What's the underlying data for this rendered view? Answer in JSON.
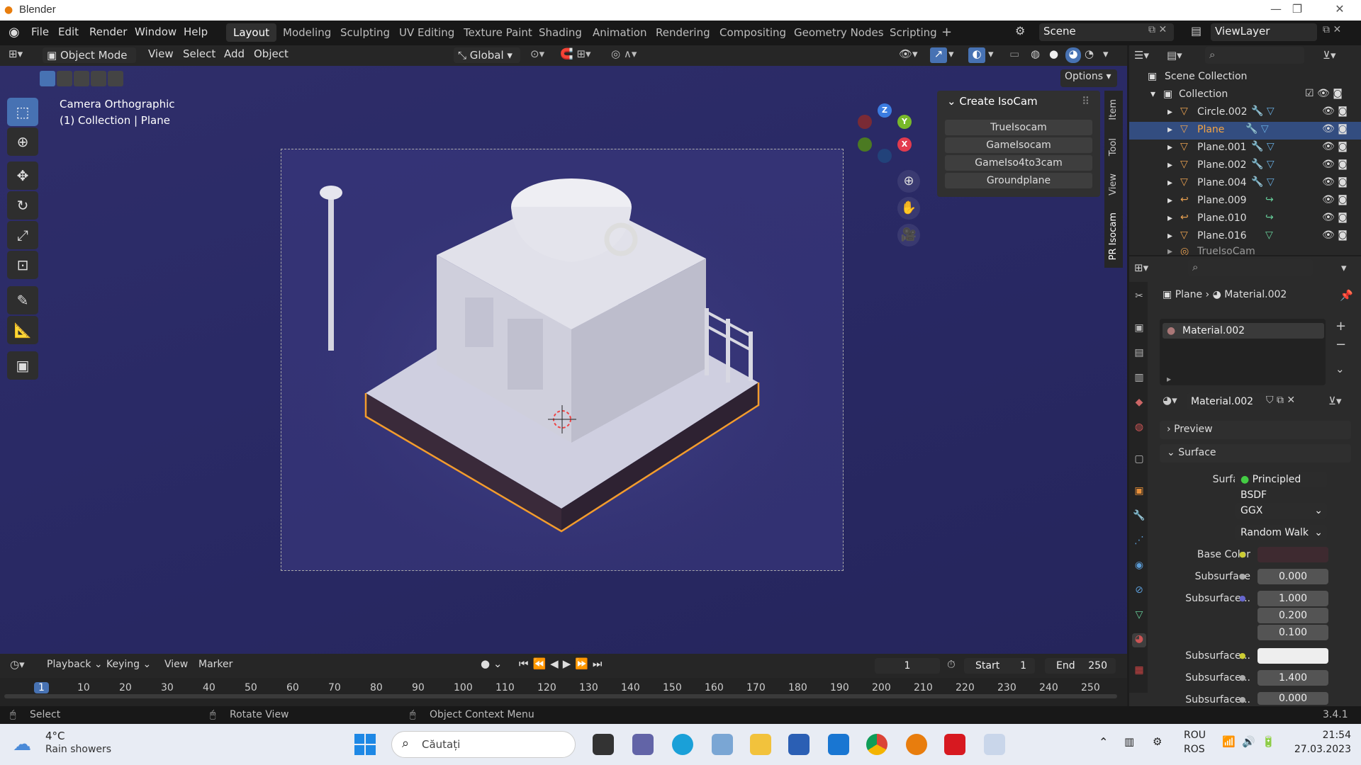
{
  "titlebar": {
    "app": "Blender"
  },
  "menu": [
    "File",
    "Edit",
    "Render",
    "Window",
    "Help"
  ],
  "workspaces": [
    "Layout",
    "Modeling",
    "Sculpting",
    "UV Editing",
    "Texture Paint",
    "Shading",
    "Animation",
    "Rendering",
    "Compositing",
    "Geometry Nodes",
    "Scripting"
  ],
  "scene": {
    "name": "Scene",
    "view_layer": "ViewLayer"
  },
  "viewport_header": {
    "mode": "Object Mode",
    "items": [
      "View",
      "Select",
      "Add",
      "Object"
    ],
    "orientation": "Global",
    "options": "Options"
  },
  "viewport": {
    "camera_label": "Camera Orthographic",
    "collection_label": "(1) Collection | Plane"
  },
  "npanel": {
    "title": "Create IsoCam",
    "buttons": [
      "TrueIsocam",
      "GameIsocam",
      "GameIso4to3cam",
      "Groundplane"
    ],
    "tabs": [
      "Item",
      "Tool",
      "View",
      "PR Isocam"
    ]
  },
  "outliner": {
    "root": "Scene Collection",
    "collection": "Collection",
    "items": [
      "Circle.002",
      "Plane",
      "Plane.001",
      "Plane.002",
      "Plane.004",
      "Plane.009",
      "Plane.010",
      "Plane.016",
      "TrueIsoCam"
    ]
  },
  "properties": {
    "breadcrumb_object": "Plane",
    "breadcrumb_material": "Material.002",
    "slot": "Material.002",
    "material": "Material.002",
    "preview": "Preview",
    "surface_section": "Surface",
    "surface_label": "Surface",
    "surface_value": "Principled BSDF",
    "distribution": "GGX",
    "subsurface_method": "Random Walk",
    "rows": [
      {
        "label": "Base Color",
        "value": ""
      },
      {
        "label": "Subsurface",
        "value": "0.000"
      },
      {
        "label": "Subsurface...",
        "value": "1.000"
      },
      {
        "label": "",
        "value": "0.200"
      },
      {
        "label": "",
        "value": "0.100"
      },
      {
        "label": "Subsurface...",
        "value": ""
      },
      {
        "label": "Subsurface...",
        "value": "1.400"
      },
      {
        "label": "Subsurface...",
        "value": "0.000"
      }
    ]
  },
  "timeline": {
    "menus": [
      "Playback",
      "Keying",
      "View",
      "Marker"
    ],
    "current_frame": "1",
    "start_label": "Start",
    "start": "1",
    "end_label": "End",
    "end": "250",
    "ticks": [
      "1",
      "10",
      "20",
      "30",
      "40",
      "50",
      "60",
      "70",
      "80",
      "90",
      "100",
      "110",
      "120",
      "130",
      "140",
      "150",
      "160",
      "170",
      "180",
      "190",
      "200",
      "210",
      "220",
      "230",
      "240",
      "250"
    ]
  },
  "status": {
    "select": "Select",
    "rotate": "Rotate View",
    "context": "Object Context Menu",
    "version": "3.4.1"
  },
  "taskbar": {
    "weather_temp": "4°C",
    "weather_desc": "Rain showers",
    "search_placeholder": "Căutați",
    "lang1": "ROU",
    "lang2": "ROS",
    "time": "21:54",
    "date": "27.03.2023"
  },
  "colors": {
    "accent": "#4772b3",
    "selection": "#e87d0d",
    "viewport_bg": "#2c2b66"
  }
}
